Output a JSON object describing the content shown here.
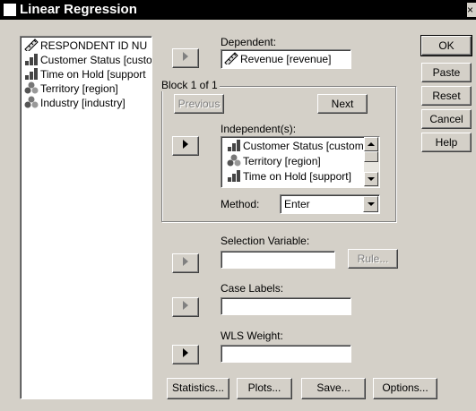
{
  "window": {
    "title": "Linear Regression",
    "close": "×"
  },
  "variables": [
    {
      "label": "RESPONDENT ID NU",
      "icon": "ruler-icon"
    },
    {
      "label": "Customer Status [custo",
      "icon": "ordinal-bar-icon"
    },
    {
      "label": "Time on Hold [support",
      "icon": "ordinal-bar-icon"
    },
    {
      "label": "Territory [region]",
      "icon": "nominal-balls-icon"
    },
    {
      "label": "Industry [industry]",
      "icon": "nominal-balls-icon"
    }
  ],
  "dependent": {
    "label": "Dependent:",
    "value": "Revenue [revenue]"
  },
  "block": {
    "label": "Block 1 of 1",
    "previous": "Previous",
    "next": "Next"
  },
  "independents": {
    "label": "Independent(s):",
    "items": [
      {
        "label": "Customer Status [custom",
        "icon": "ordinal-bar-icon"
      },
      {
        "label": "Territory [region]",
        "icon": "nominal-balls-icon"
      },
      {
        "label": "Time on Hold [support]",
        "icon": "ordinal-bar-icon"
      }
    ]
  },
  "method": {
    "label": "Method:",
    "value": "Enter"
  },
  "selection": {
    "label": "Selection Variable:",
    "value": "",
    "rule": "Rule..."
  },
  "case_labels": {
    "label": "Case Labels:",
    "value": ""
  },
  "wls": {
    "label": "WLS Weight:",
    "value": ""
  },
  "side_buttons": {
    "ok": "OK",
    "paste": "Paste",
    "reset": "Reset",
    "cancel": "Cancel",
    "help": "Help"
  },
  "bottom_buttons": {
    "statistics": "Statistics...",
    "plots": "Plots...",
    "save": "Save...",
    "options": "Options..."
  }
}
